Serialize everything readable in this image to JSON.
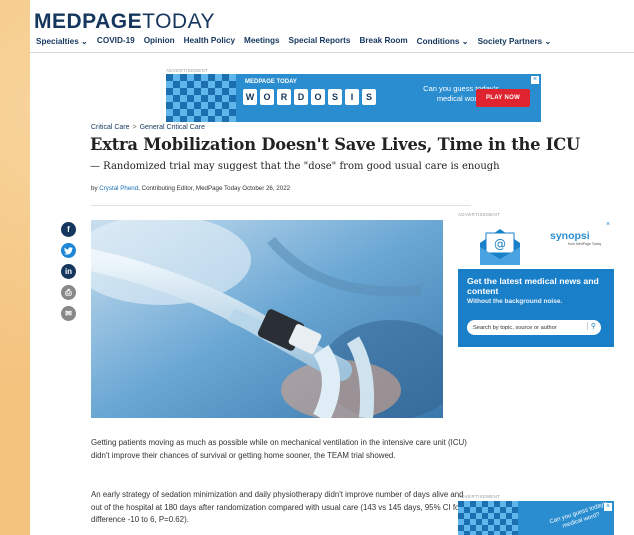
{
  "header": {
    "logo_bold": "MEDPAGE",
    "logo_light": "TODAY",
    "nav": [
      {
        "label": "Specialties",
        "dropdown": true
      },
      {
        "label": "COVID-19",
        "dropdown": false
      },
      {
        "label": "Opinion",
        "dropdown": false
      },
      {
        "label": "Health Policy",
        "dropdown": false
      },
      {
        "label": "Meetings",
        "dropdown": false
      },
      {
        "label": "Special Reports",
        "dropdown": false
      },
      {
        "label": "Break Room",
        "dropdown": false
      },
      {
        "label": "Conditions",
        "dropdown": true
      },
      {
        "label": "Society Partners",
        "dropdown": true
      }
    ]
  },
  "top_ad": {
    "label": "ADVERTISEMENT",
    "brand": "MEDPAGE TODAY",
    "letters": [
      "W",
      "O",
      "R",
      "D",
      "O",
      "S",
      "I",
      "S"
    ],
    "question": "Can you guess today's medical word?",
    "button": "PLAY NOW",
    "close": "×"
  },
  "article": {
    "breadcrumb": [
      "Critical Care",
      "General Critical Care"
    ],
    "breadcrumb_sep": ">",
    "title": "Extra Mobilization Doesn't Save Lives, Time in the ICU",
    "subtitle": "— Randomized trial may suggest that the \"dose\" from good usual care is enough",
    "byline_prefix": "by",
    "author": "Crystal Phend",
    "byline_rest": ", Contributing Editor, MedPage Today October 26, 2022",
    "p1": "Getting patients moving as much as possible while on mechanical ventilation in the intensive care unit (ICU) didn't improve their chances of survival or getting home sooner, the TEAM trial showed.",
    "p2": "An early strategy of sedation minimization and daily physiotherapy didn't improve number of days alive and out of the hospital at 180 days after randomization compared with usual care (143 vs 145 days, 95% CI for difference -10 to 6, P=0.62)."
  },
  "share": {
    "facebook": "f",
    "twitter": "t",
    "linkedin": "in",
    "print": "⎙",
    "email": "✉"
  },
  "side_ad": {
    "label": "ADVERTISEMENT",
    "brand": "synopsi",
    "brand_sub": "from MedPage Today",
    "headline": "Get the latest medical news and content",
    "tagline": "Without the background noise.",
    "search_placeholder": "Search by topic, source or author",
    "close": "×"
  },
  "side_ad2": {
    "label": "ADVERTISEMENT",
    "question": "Can you guess today's medical word?",
    "close": "×"
  },
  "colors": {
    "brand_navy": "#15375e",
    "link_blue": "#1a6fb5",
    "ad_blue": "#2a8dcf",
    "play_red": "#e0242f"
  }
}
